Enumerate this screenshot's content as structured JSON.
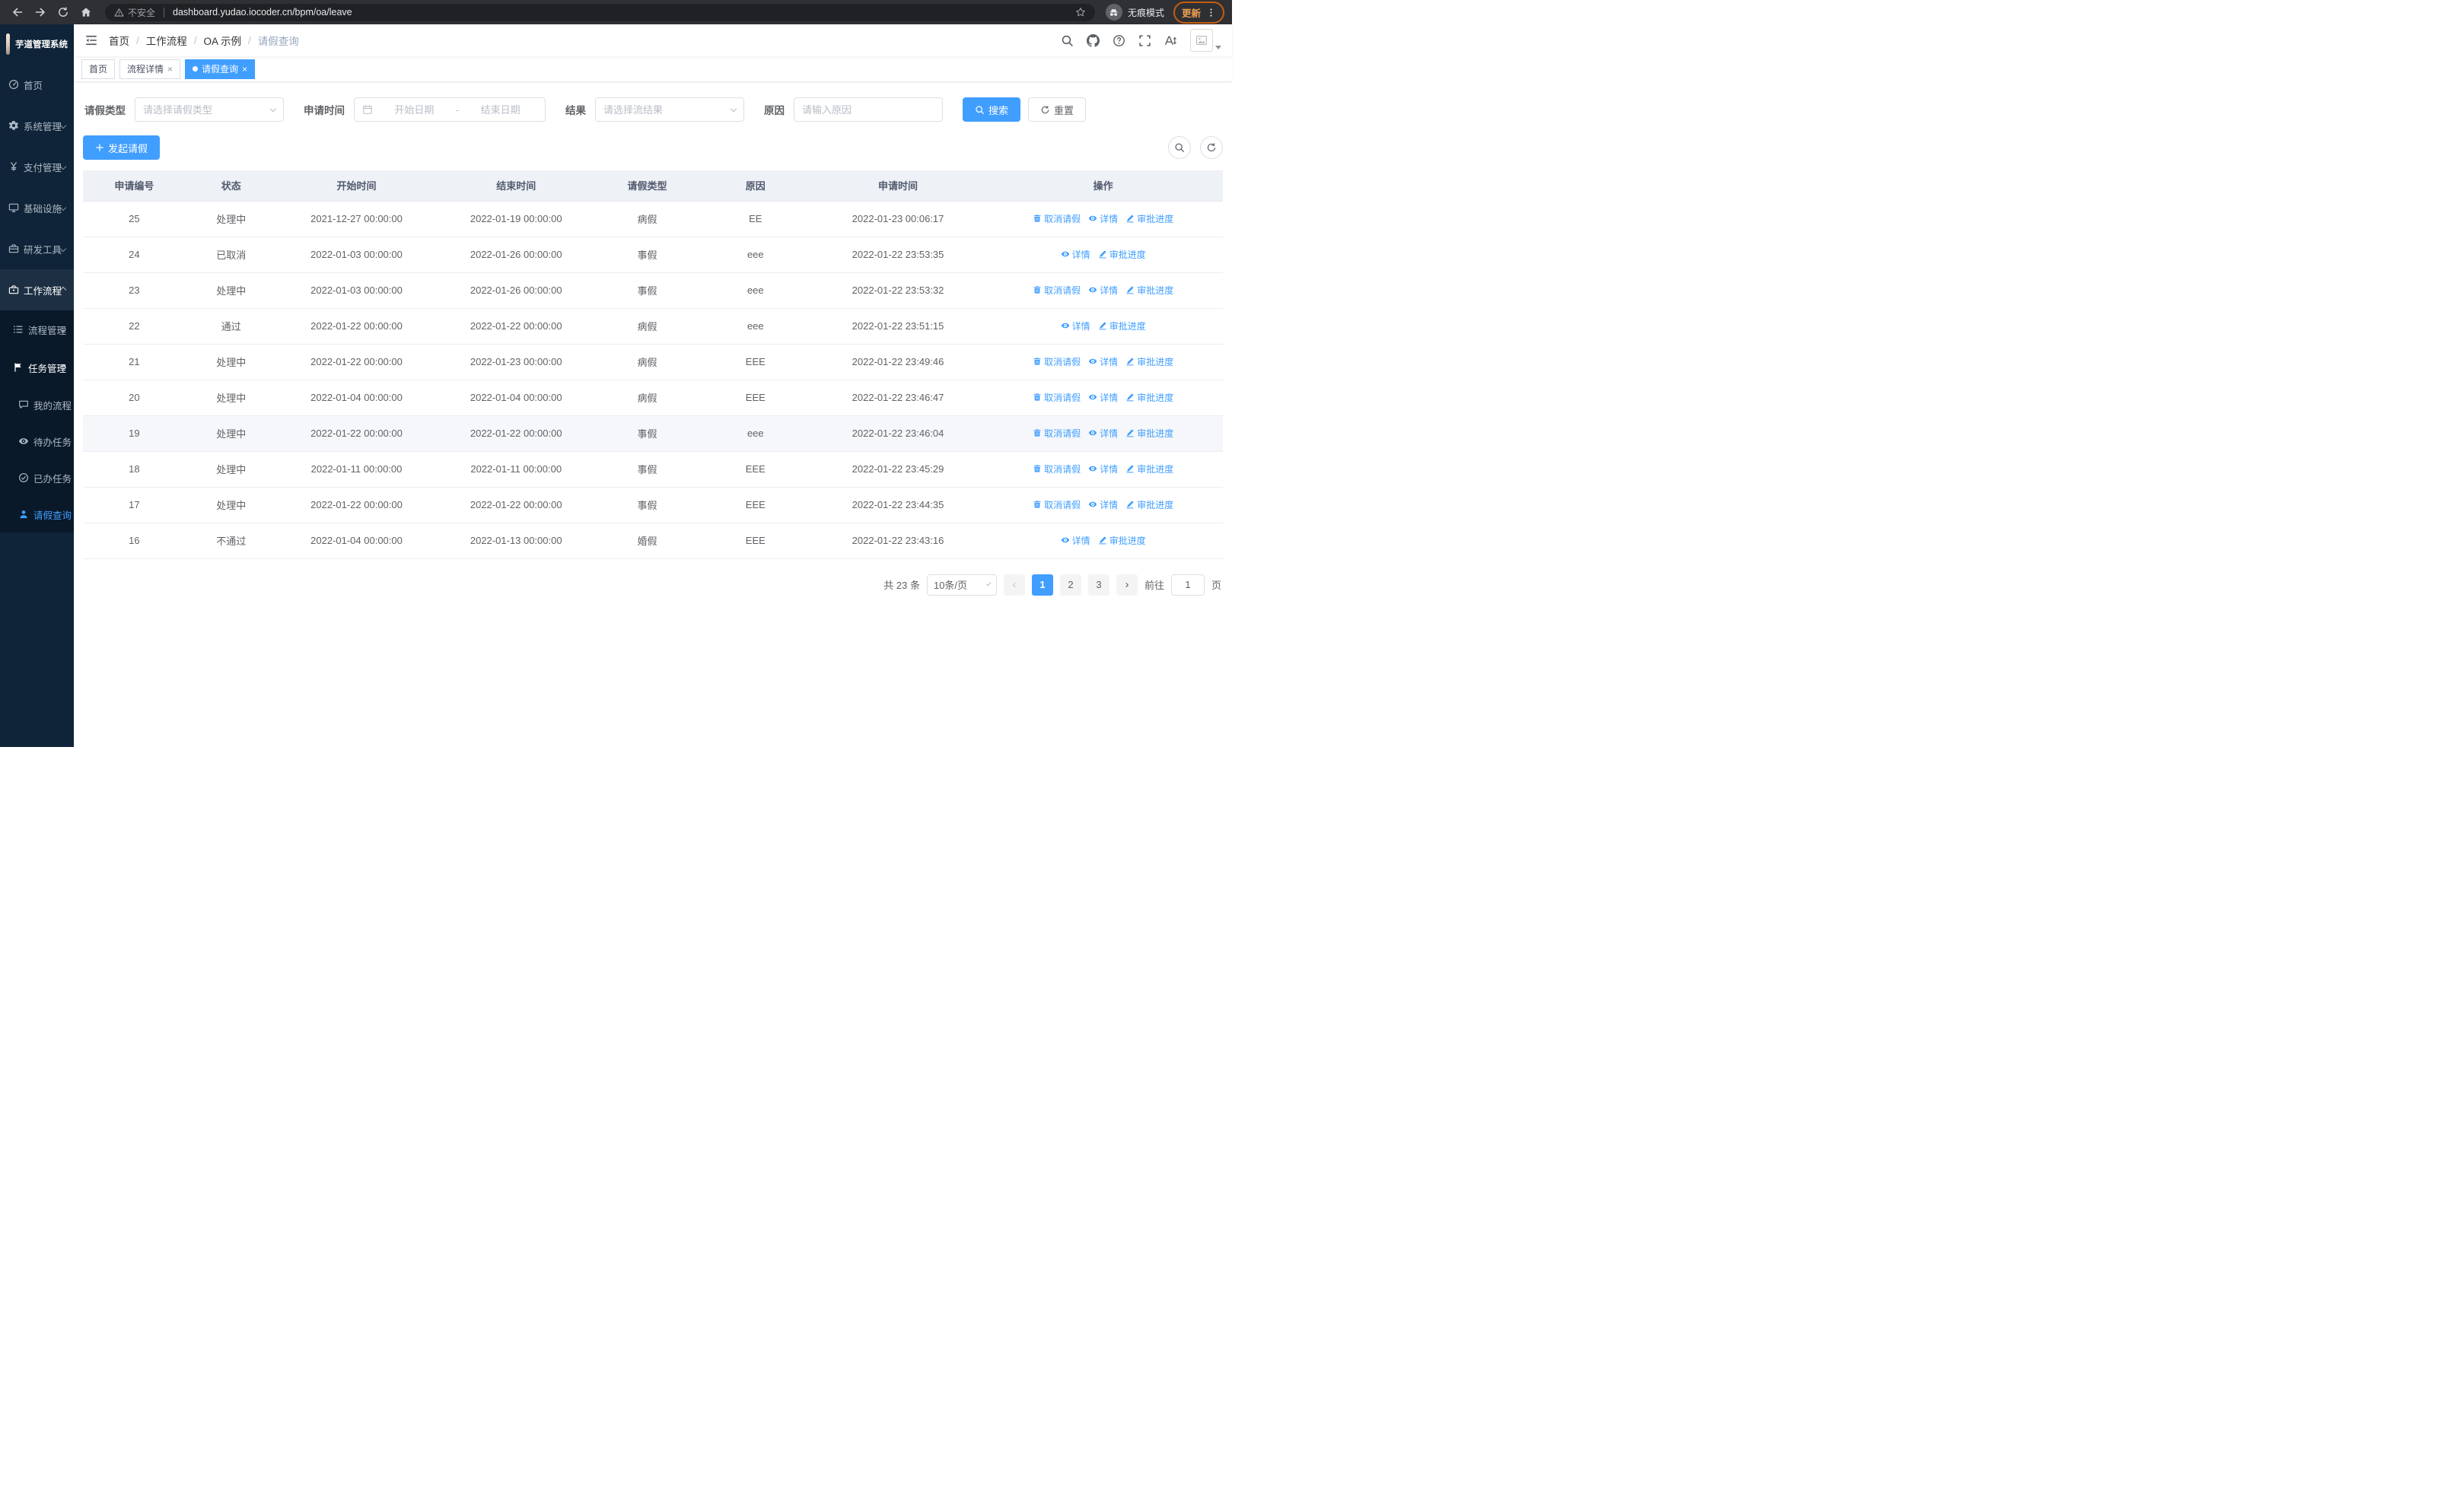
{
  "colors": {
    "accent": "#409eff",
    "sidebar_bg": "#0f2438",
    "update_orange": "#f0a04f"
  },
  "browser": {
    "security": "不安全",
    "url": "dashboard.yudao.iocoder.cn/bpm/oa/leave",
    "incognito": "无痕模式",
    "update": "更新"
  },
  "sidebar": {
    "title": "芋道管理系统",
    "items": {
      "home": "首页",
      "system": "系统管理",
      "pay": "支付管理",
      "infra": "基础设施",
      "dev": "研发工具",
      "workflow": "工作流程",
      "process": "流程管理",
      "task": "任务管理",
      "my_process": "我的流程",
      "todo": "待办任务",
      "done": "已办任务",
      "leave": "请假查询"
    }
  },
  "breadcrumb": {
    "items": [
      "首页",
      "工作流程",
      "OA 示例",
      "请假查询"
    ]
  },
  "tabs": {
    "home": "首页",
    "detail": "流程详情",
    "leave": "请假查询"
  },
  "filters": {
    "leave_type_label": "请假类型",
    "leave_type_placeholder": "请选择请假类型",
    "apply_time_label": "申请时间",
    "start_date_placeholder": "开始日期",
    "range_separator": "-",
    "end_date_placeholder": "结束日期",
    "result_label": "结果",
    "result_placeholder": "请选择流结果",
    "reason_label": "原因",
    "reason_placeholder": "请输入原因",
    "search_label": "搜索",
    "reset_label": "重置"
  },
  "toolbar": {
    "create_label": "发起请假"
  },
  "table": {
    "headers": [
      "申请编号",
      "状态",
      "开始时间",
      "结束时间",
      "请假类型",
      "原因",
      "申请时间",
      "操作"
    ],
    "actions": {
      "cancel": "取消请假",
      "detail": "详情",
      "progress": "审批进度"
    },
    "rows": [
      {
        "id": "25",
        "status": "处理中",
        "start": "2021-12-27 00:00:00",
        "end": "2022-01-19 00:00:00",
        "type": "病假",
        "reason": "EE",
        "applied": "2022-01-23 00:06:17",
        "ops": [
          "cancel",
          "detail",
          "progress"
        ],
        "hover": false
      },
      {
        "id": "24",
        "status": "已取消",
        "start": "2022-01-03 00:00:00",
        "end": "2022-01-26 00:00:00",
        "type": "事假",
        "reason": "eee",
        "applied": "2022-01-22 23:53:35",
        "ops": [
          "detail",
          "progress"
        ],
        "hover": false
      },
      {
        "id": "23",
        "status": "处理中",
        "start": "2022-01-03 00:00:00",
        "end": "2022-01-26 00:00:00",
        "type": "事假",
        "reason": "eee",
        "applied": "2022-01-22 23:53:32",
        "ops": [
          "cancel",
          "detail",
          "progress"
        ],
        "hover": false
      },
      {
        "id": "22",
        "status": "通过",
        "start": "2022-01-22 00:00:00",
        "end": "2022-01-22 00:00:00",
        "type": "病假",
        "reason": "eee",
        "applied": "2022-01-22 23:51:15",
        "ops": [
          "detail",
          "progress"
        ],
        "hover": false
      },
      {
        "id": "21",
        "status": "处理中",
        "start": "2022-01-22 00:00:00",
        "end": "2022-01-23 00:00:00",
        "type": "病假",
        "reason": "EEE",
        "applied": "2022-01-22 23:49:46",
        "ops": [
          "cancel",
          "detail",
          "progress"
        ],
        "hover": false
      },
      {
        "id": "20",
        "status": "处理中",
        "start": "2022-01-04 00:00:00",
        "end": "2022-01-04 00:00:00",
        "type": "病假",
        "reason": "EEE",
        "applied": "2022-01-22 23:46:47",
        "ops": [
          "cancel",
          "detail",
          "progress"
        ],
        "hover": false
      },
      {
        "id": "19",
        "status": "处理中",
        "start": "2022-01-22 00:00:00",
        "end": "2022-01-22 00:00:00",
        "type": "事假",
        "reason": "eee",
        "applied": "2022-01-22 23:46:04",
        "ops": [
          "cancel",
          "detail",
          "progress"
        ],
        "hover": true
      },
      {
        "id": "18",
        "status": "处理中",
        "start": "2022-01-11 00:00:00",
        "end": "2022-01-11 00:00:00",
        "type": "事假",
        "reason": "EEE",
        "applied": "2022-01-22 23:45:29",
        "ops": [
          "cancel",
          "detail",
          "progress"
        ],
        "hover": false
      },
      {
        "id": "17",
        "status": "处理中",
        "start": "2022-01-22 00:00:00",
        "end": "2022-01-22 00:00:00",
        "type": "事假",
        "reason": "EEE",
        "applied": "2022-01-22 23:44:35",
        "ops": [
          "cancel",
          "detail",
          "progress"
        ],
        "hover": false
      },
      {
        "id": "16",
        "status": "不通过",
        "start": "2022-01-04 00:00:00",
        "end": "2022-01-13 00:00:00",
        "type": "婚假",
        "reason": "EEE",
        "applied": "2022-01-22 23:43:16",
        "ops": [
          "detail",
          "progress"
        ],
        "hover": false
      }
    ]
  },
  "pagination": {
    "total": "共 23 条",
    "page_size": "10条/页",
    "pages": [
      "1",
      "2",
      "3"
    ],
    "goto_label": "前往",
    "goto_value": "1",
    "unit": "页"
  }
}
